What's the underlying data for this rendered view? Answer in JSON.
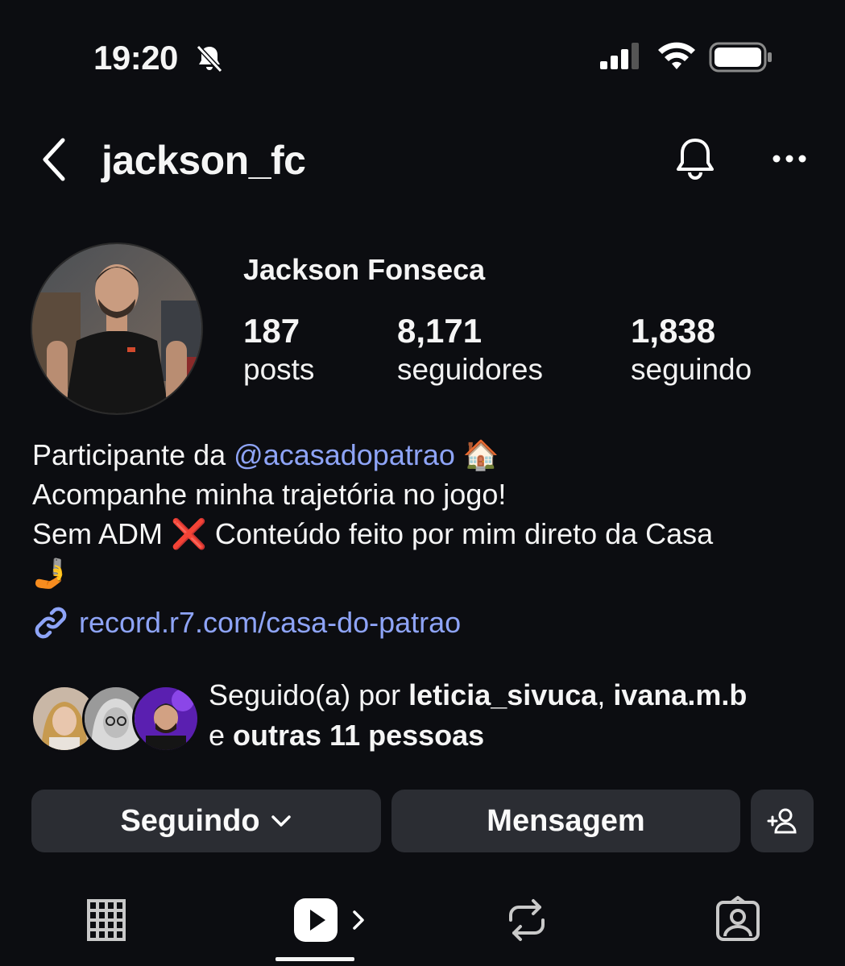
{
  "status_bar": {
    "time": "19:20",
    "icons": [
      "bell-slash-icon",
      "signal-icon",
      "wifi-icon",
      "battery-icon"
    ]
  },
  "header": {
    "username": "jackson_fc",
    "icons": [
      "chevron-left-icon",
      "bell-icon",
      "ellipsis-icon"
    ]
  },
  "profile": {
    "full_name": "Jackson Fonseca",
    "stats": {
      "posts": {
        "value": "187",
        "label": "posts"
      },
      "followers": {
        "value": "8,171",
        "label": "seguidores"
      },
      "following": {
        "value": "1,838",
        "label": "seguindo"
      }
    }
  },
  "bio": {
    "line1_prefix": "Participante da ",
    "line1_mention": "@acasadopatrao",
    "line1_emoji": "🏠",
    "line2": "Acompanhe minha trajetória no jogo!",
    "line3_prefix": "Sem ADM ",
    "line3_emoji": "❌",
    "line3_suffix": " Conteúdo feito por mim direto da Casa",
    "line4_emoji": "🤳",
    "link": "record.r7.com/casa-do-patrao"
  },
  "followed_by": {
    "prefix": "Seguido(a) por ",
    "user1": "leticia_sivuca",
    "separator": ", ",
    "user2": "ivana.m.b",
    "conj": "e ",
    "others": "outras 11 pessoas"
  },
  "buttons": {
    "following": "Seguindo",
    "message": "Mensagem"
  },
  "tabs": [
    "grid-icon",
    "reels-icon",
    "repost-icon",
    "tagged-icon"
  ],
  "colors": {
    "background": "#0c0d11",
    "link": "#8ea4f7",
    "button_bg": "#2b2d33"
  }
}
